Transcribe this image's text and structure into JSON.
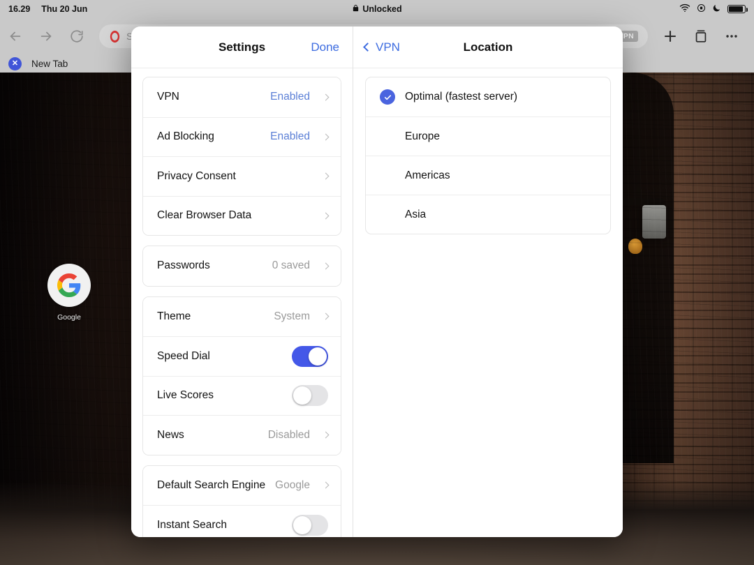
{
  "statusbar": {
    "time": "16.29",
    "date": "Thu 20 Jun",
    "center_label": "Unlocked",
    "lock_icon": "lock-icon",
    "wifi_icon": "wifi-icon",
    "rotation_icon": "rotation-lock-icon",
    "dnd_icon": "moon-icon",
    "battery_icon": "battery-icon"
  },
  "browser": {
    "back_icon": "back-arrow-icon",
    "forward_icon": "forward-arrow-icon",
    "reload_icon": "reload-icon",
    "address_placeholder": "Search or enter address",
    "address_value": "",
    "vpn_badge": "VPN",
    "new_tab_icon": "plus-icon",
    "tabs_icon": "tab-stack-icon",
    "menu_icon": "more-options-icon",
    "tab": {
      "title": "New Tab",
      "close_icon": "close-tab-icon",
      "close_glyph": "✕"
    }
  },
  "speed_dial": {
    "items": [
      {
        "label": "Google",
        "icon": "google-logo-icon"
      }
    ]
  },
  "settings_panel": {
    "title": "Settings",
    "done_label": "Done",
    "groups": [
      {
        "rows": [
          {
            "label": "VPN",
            "value": "Enabled",
            "value_style": "accent",
            "control": "chevron"
          },
          {
            "label": "Ad Blocking",
            "value": "Enabled",
            "value_style": "accent",
            "control": "chevron"
          },
          {
            "label": "Privacy Consent",
            "value": "",
            "value_style": "muted",
            "control": "chevron"
          },
          {
            "label": "Clear Browser Data",
            "value": "",
            "value_style": "muted",
            "control": "chevron"
          }
        ]
      },
      {
        "rows": [
          {
            "label": "Passwords",
            "value": "0 saved",
            "value_style": "muted",
            "control": "chevron"
          }
        ]
      },
      {
        "rows": [
          {
            "label": "Theme",
            "value": "System",
            "value_style": "muted",
            "control": "chevron"
          },
          {
            "label": "Speed Dial",
            "value": "",
            "value_style": "muted",
            "control": "toggle",
            "toggle_on": true
          },
          {
            "label": "Live Scores",
            "value": "",
            "value_style": "muted",
            "control": "toggle",
            "toggle_on": false
          },
          {
            "label": "News",
            "value": "Disabled",
            "value_style": "muted",
            "control": "chevron"
          }
        ]
      },
      {
        "rows": [
          {
            "label": "Default Search Engine",
            "value": "Google",
            "value_style": "muted",
            "control": "chevron"
          },
          {
            "label": "Instant Search",
            "value": "",
            "value_style": "muted",
            "control": "toggle",
            "toggle_on": false
          }
        ]
      }
    ]
  },
  "location_panel": {
    "title": "Location",
    "back_label": "VPN",
    "back_icon": "chevron-left-icon",
    "options": [
      {
        "label": "Optimal (fastest server)",
        "selected": true
      },
      {
        "label": "Europe",
        "selected": false
      },
      {
        "label": "Americas",
        "selected": false
      },
      {
        "label": "Asia",
        "selected": false
      }
    ]
  },
  "colors": {
    "accent_blue": "#3d6ce0",
    "toggle_on": "#4458e8",
    "check_blue": "#4a64df",
    "value_muted": "#9a9a9a",
    "chrome_grey": "#c9c9c9"
  }
}
